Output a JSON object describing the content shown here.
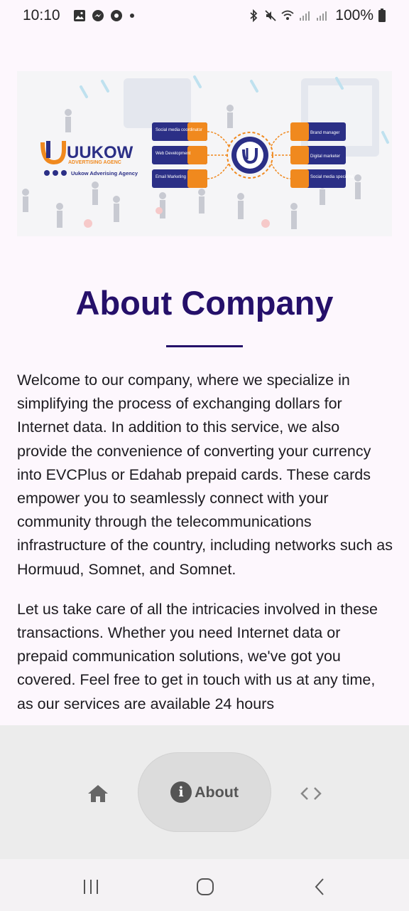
{
  "status_bar": {
    "time": "10:10",
    "battery": "100%",
    "left_icons": [
      "gallery-icon",
      "messenger-icon",
      "chat-icon",
      "dot-icon"
    ],
    "right_icons": [
      "bluetooth-icon",
      "mute-icon",
      "wifi-icon",
      "signal-icon",
      "signal-icon",
      "battery-icon"
    ]
  },
  "banner": {
    "brand": "UUKOW",
    "tagline": "ADVERTISING AGENC",
    "agency": "Uukow Adverising Agency",
    "left_items": [
      "Social media coordinator",
      "Web Development",
      "Email Marketing"
    ],
    "right_items": [
      "Brand manager",
      "Digital marketer",
      "Social media specialist"
    ]
  },
  "page": {
    "title": "About Company",
    "paragraphs": [
      "Welcome to our company, where we specialize in simplifying the process of exchanging dollars for Internet data. In addition to this service, we also provide the convenience of converting your currency into EVCPlus or Edahab prepaid cards. These cards empower you to seamlessly connect with your community through the telecommunications infrastructure of the country, including networks such as Hormuud, Somnet, and Somnet.",
      "Let us take care of all the intricacies involved in these transactions. Whether you need Internet data or prepaid communication solutions, we've got you covered. Feel free to get in touch with us at any time, as our services are available 24 hours"
    ]
  },
  "bottom_nav": {
    "items": [
      {
        "icon": "home-icon",
        "label": ""
      },
      {
        "icon": "info-icon",
        "label": "About"
      },
      {
        "icon": "code-icon",
        "label": ""
      }
    ],
    "active": "About"
  },
  "colors": {
    "title": "#25106a",
    "accent_orange": "#f0891e",
    "accent_navy": "#2b2f86",
    "nav_bg": "#ececec"
  }
}
